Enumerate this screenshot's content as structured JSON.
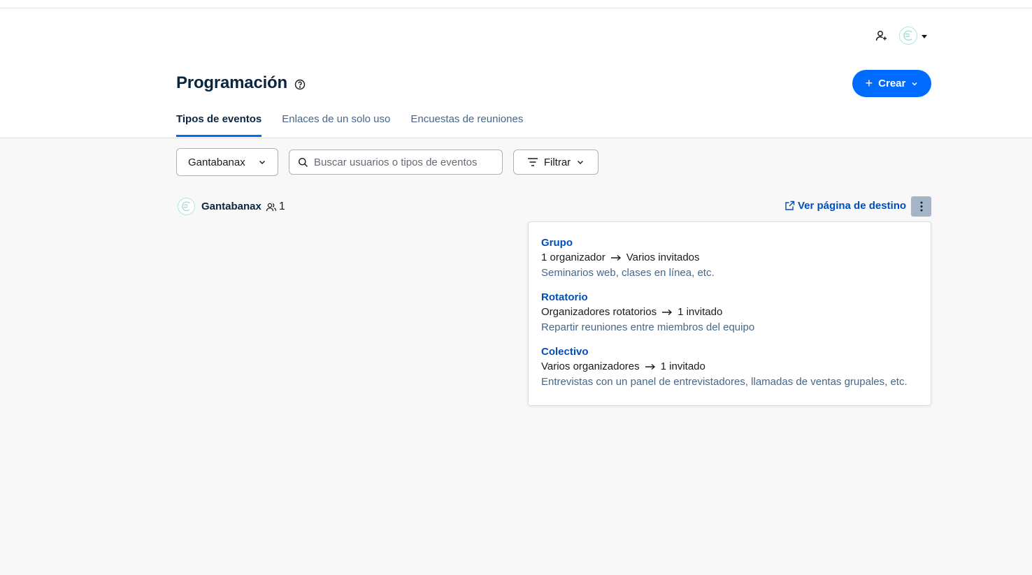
{
  "header": {
    "title": "Programación",
    "create_label": "Crear",
    "tabs": [
      {
        "label": "Tipos de eventos",
        "active": true
      },
      {
        "label": "Enlaces de un solo uso",
        "active": false
      },
      {
        "label": "Encuestas de reuniones",
        "active": false
      }
    ]
  },
  "filters": {
    "user_select_value": "Gantabanax",
    "search_placeholder": "Buscar usuarios o tipos de eventos",
    "filter_label": "Filtrar"
  },
  "user_section": {
    "name": "Gantabanax",
    "member_count": "1",
    "landing_page_label": "Ver página de destino"
  },
  "dropdown": {
    "options": [
      {
        "title": "Grupo",
        "from": "1 organizador",
        "to": "Varios invitados",
        "description": "Seminarios web, clases en línea, etc."
      },
      {
        "title": "Rotatorio",
        "from": "Organizadores rotatorios",
        "to": "1 invitado",
        "description": "Repartir reuniones entre miembros del equipo"
      },
      {
        "title": "Colectivo",
        "from": "Varios organizadores",
        "to": "1 invitado",
        "description": "Entrevistas con un panel de entrevistadores, llamadas de ventas grupales, etc."
      }
    ]
  },
  "colors": {
    "accent": "#006bff",
    "link": "#004eba",
    "heading": "#0a2540",
    "muted": "#476788",
    "background": "#f8f8f8"
  },
  "icons": [
    "add-user-icon",
    "avatar-icon",
    "help-icon",
    "plus-icon",
    "chevron-down-icon",
    "search-icon",
    "filter-icon",
    "team-members-icon",
    "external-link-icon",
    "kebab-menu-icon",
    "arrow-right-icon"
  ]
}
